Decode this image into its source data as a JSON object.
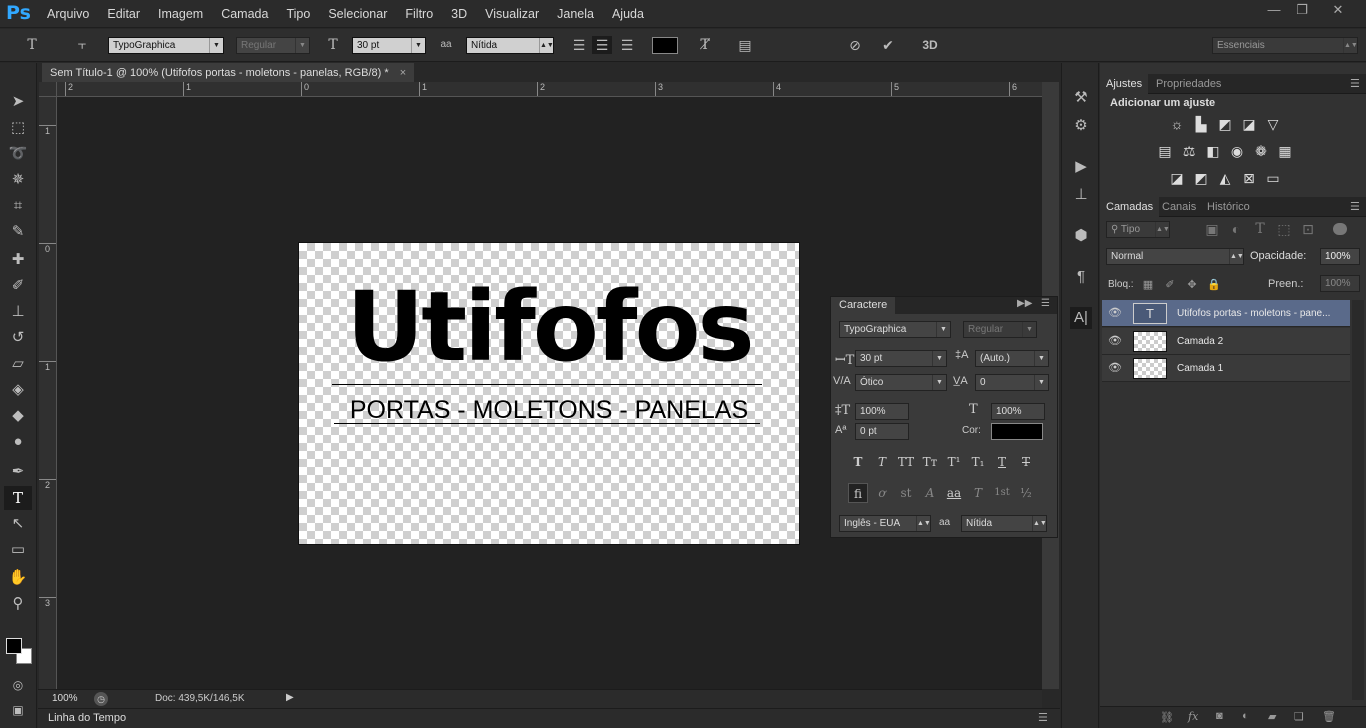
{
  "app": {
    "logo": "Ps"
  },
  "menu": [
    "Arquivo",
    "Editar",
    "Imagem",
    "Camada",
    "Tipo",
    "Selecionar",
    "Filtro",
    "3D",
    "Visualizar",
    "Janela",
    "Ajuda"
  ],
  "window": {
    "minimize": "—",
    "restore": "❐",
    "close": "✕"
  },
  "options": {
    "font_family": "TypoGraphica",
    "font_style": "Regular",
    "font_size": "30 pt",
    "aa_icon": "aa",
    "antialias": "Nítida",
    "text_color": "#000000",
    "label_3d": "3D",
    "workspace": "Essenciais"
  },
  "document": {
    "tab_title": "Sem Título-1 @ 100% (Utifofos portas - moletons - panelas, RGB/8) *",
    "close": "×",
    "headline": "Utifofos",
    "subline": "PORTAS - MOLETONS - PANELAS"
  },
  "rulers": {
    "h_ticks": [
      "2",
      "1",
      "0",
      "1",
      "2",
      "3",
      "4",
      "5",
      "6"
    ],
    "v_ticks": [
      "1",
      "0",
      "1",
      "2",
      "3"
    ]
  },
  "status": {
    "zoom": "100%",
    "doc": "Doc: 439,5K/146,5K"
  },
  "timeline": {
    "label": "Linha do Tempo"
  },
  "adjustments": {
    "tabs": [
      "Ajustes",
      "Propriedades"
    ],
    "heading": "Adicionar um ajuste"
  },
  "layers": {
    "tabs": [
      "Camadas",
      "Canais",
      "Histórico"
    ],
    "filter": "Tipo",
    "blend": "Normal",
    "opacity_label": "Opacidade:",
    "opacity": "100%",
    "lock_label": "Bloq.:",
    "fill_label": "Preen.:",
    "fill": "100%",
    "items": [
      {
        "name": "Utifofos portas - moletons - pane...",
        "thumb": "T"
      },
      {
        "name": "Camada 2",
        "thumb": ""
      },
      {
        "name": "Camada 1",
        "thumb": ""
      }
    ]
  },
  "character": {
    "title": "Caractere",
    "font_family": "TypoGraphica",
    "font_style": "Regular",
    "size": "30 pt",
    "leading": "(Auto.)",
    "kerning": "Ótico",
    "tracking": "0",
    "vscale": "100%",
    "hscale": "100%",
    "baseline": "0 pt",
    "color_label": "Cor:",
    "color": "#000000",
    "language": "Inglês - EUA",
    "antialias": "Nítida",
    "aa_icon": "aa"
  }
}
